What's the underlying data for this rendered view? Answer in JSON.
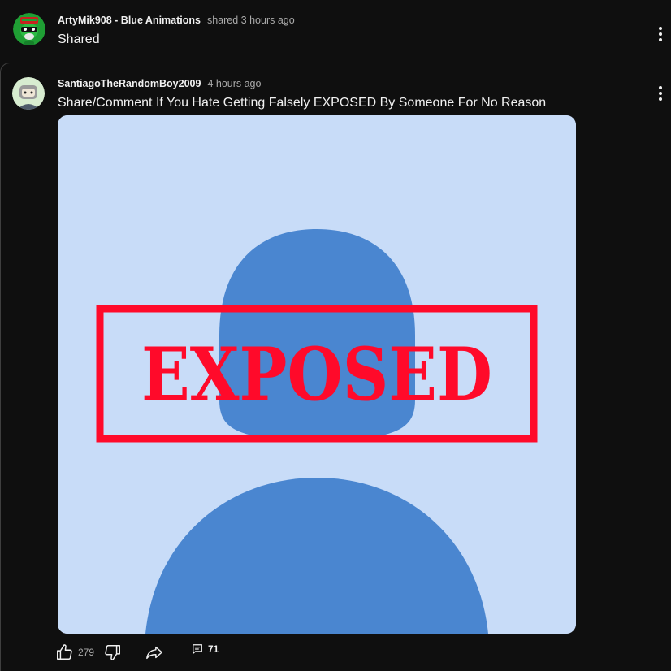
{
  "share_post": {
    "author": "ArtyMik908 - Blue Animations",
    "meta": "shared 3 hours ago",
    "text": "Shared"
  },
  "original_post": {
    "author": "SantiagoTheRandomBoy2009",
    "meta": "4 hours ago",
    "text": "Share/Comment If You Hate Getting Falsely EXPOSED By Someone For No Reason",
    "image": {
      "stamp_text": "EXPOSED",
      "background_color": "#c8dcf8",
      "silhouette_color": "#4a86d0",
      "stamp_color": "#ff0a2a"
    },
    "actions": {
      "like_count": "279",
      "comment_count": "71"
    }
  },
  "icons": {
    "like": "thumbs-up-icon",
    "dislike": "thumbs-down-icon",
    "share": "share-arrow-icon",
    "comments": "comment-icon",
    "menu": "more-vert-icon"
  }
}
